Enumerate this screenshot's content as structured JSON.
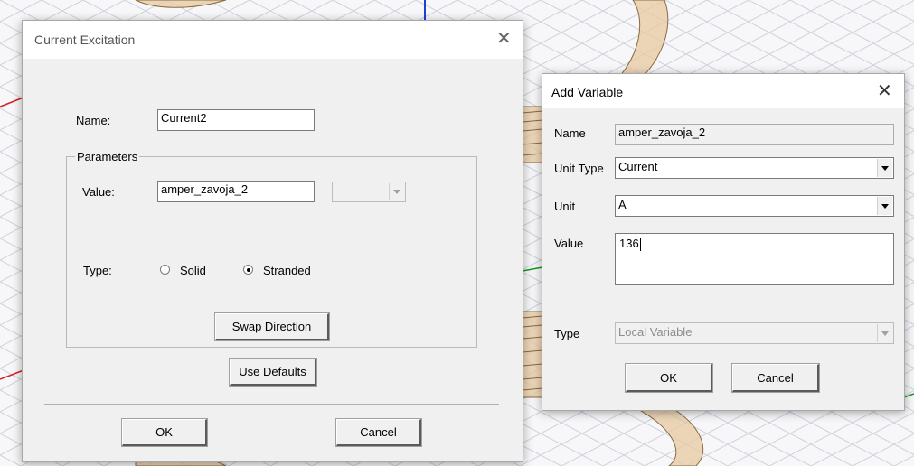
{
  "current_excitation": {
    "title": "Current Excitation",
    "name_label": "Name:",
    "name_value": "Current2",
    "parameters_label": "Parameters",
    "value_label": "Value:",
    "value_value": "amper_zavoja_2",
    "unit_value": "",
    "type_label": "Type:",
    "radio_solid": "Solid",
    "radio_stranded": "Stranded",
    "selected_type": "Stranded",
    "swap_direction": "Swap Direction",
    "use_defaults": "Use Defaults",
    "ok": "OK",
    "cancel": "Cancel"
  },
  "add_variable": {
    "title": "Add Variable",
    "name_label": "Name",
    "name_value": "amper_zavoja_2",
    "unit_type_label": "Unit Type",
    "unit_type_value": "Current",
    "unit_label": "Unit",
    "unit_value": "A",
    "value_label": "Value",
    "value_value": "136",
    "type_label": "Type",
    "type_value": "Local Variable",
    "ok": "OK",
    "cancel": "Cancel"
  },
  "colors": {
    "dialog_bg": "#f0f0f0",
    "titlebar_bg": "#ffffff",
    "grid_line": "#cfd3dc",
    "coil_fill": "#e8c9a0",
    "coil_stroke": "#8a6a40",
    "axis_red": "#d42020",
    "axis_green": "#1a9a1a",
    "axis_blue": "#2040d0"
  }
}
